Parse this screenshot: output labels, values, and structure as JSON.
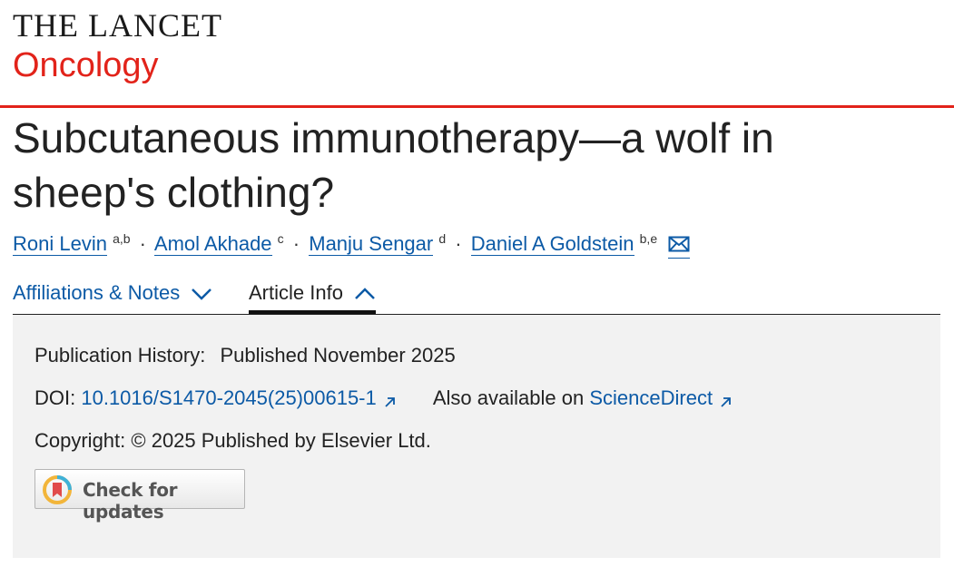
{
  "header": {
    "journal": "THE LANCET",
    "sub": "Oncology",
    "brand_color": "#e2231a"
  },
  "article": {
    "title": "Subcutaneous immunotherapy—a wolf in sheep's clothing?",
    "authors": [
      {
        "name": "Roni Levin",
        "sup": "a,b"
      },
      {
        "name": "Amol Akhade",
        "sup": "c"
      },
      {
        "name": "Manju Sengar",
        "sup": "d"
      },
      {
        "name": "Daniel A Goldstein",
        "sup": "b,e"
      }
    ],
    "separator": "·",
    "email_icon": "mail-icon"
  },
  "tabs": {
    "affiliations": "Affiliations & Notes",
    "article_info": "Article Info"
  },
  "info": {
    "pub_history_label": "Publication History:",
    "pub_history_value": "Published November 2025",
    "doi_label": "DOI:",
    "doi_value": "10.1016/S1470-2045(25)00615-1",
    "also_label": "Also available on",
    "also_link": "ScienceDirect",
    "copyright": "Copyright: © 2025 Published by Elsevier Ltd.",
    "check_updates": "Check for updates"
  },
  "colors": {
    "link": "#0c5aa6",
    "panel_bg": "#f2f2f2"
  }
}
